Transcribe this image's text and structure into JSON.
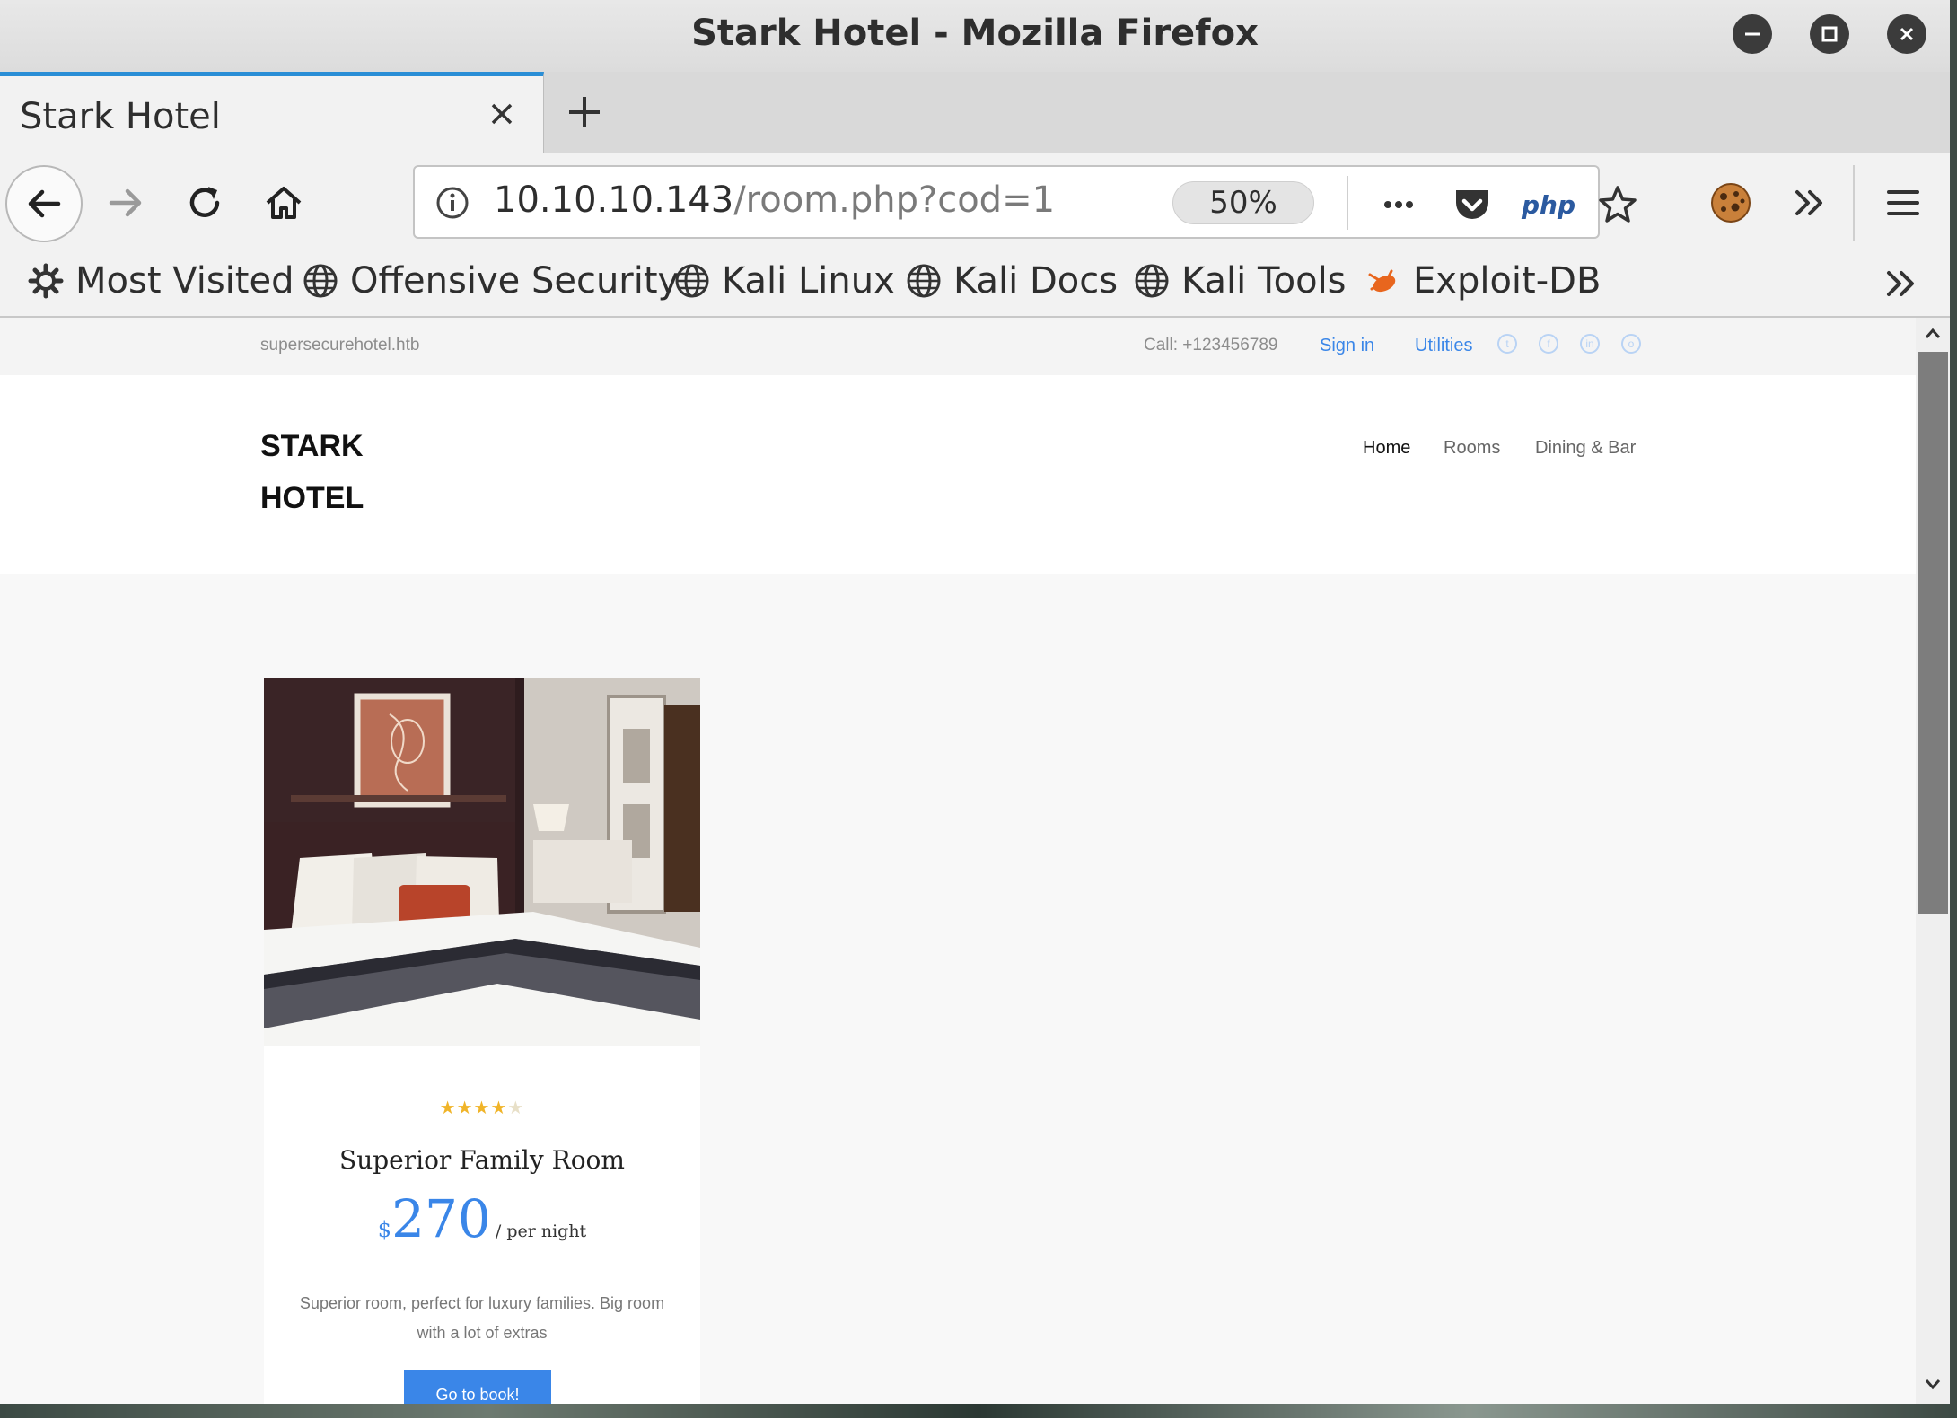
{
  "window": {
    "title": "Stark Hotel - Mozilla Firefox"
  },
  "tab": {
    "title": "Stark Hotel"
  },
  "urlbar": {
    "host": "10.10.10.143",
    "path": "/room.php?cod=1",
    "zoom": "50%",
    "php_label": "php"
  },
  "bookmarks": [
    {
      "label": "Most Visited",
      "icon": "gear-icon"
    },
    {
      "label": "Offensive Security",
      "icon": "globe-icon"
    },
    {
      "label": "Kali Linux",
      "icon": "globe-icon"
    },
    {
      "label": "Kali Docs",
      "icon": "globe-icon"
    },
    {
      "label": "Kali Tools",
      "icon": "globe-icon"
    },
    {
      "label": "Exploit-DB",
      "icon": "exploit-db-icon"
    }
  ],
  "site": {
    "domain": "supersecurehotel.htb",
    "phone": "Call: +123456789",
    "signin": "Sign in",
    "utilities": "Utilities",
    "logo_line1": "STARK",
    "logo_line2": "HOTEL",
    "nav": [
      "Home",
      "Rooms",
      "Dining & Bar"
    ]
  },
  "room": {
    "rating": 4,
    "rating_max": 5,
    "name": "Superior Family Room",
    "currency": "$",
    "price": "270",
    "per": "/ per night",
    "description": "Superior room, perfect for luxury families. Big room with a lot of extras",
    "button": "Go to book!"
  },
  "colors": {
    "accent": "#3a86e8",
    "star": "#f0b429",
    "tab_highlight": "#2a8ed6"
  }
}
